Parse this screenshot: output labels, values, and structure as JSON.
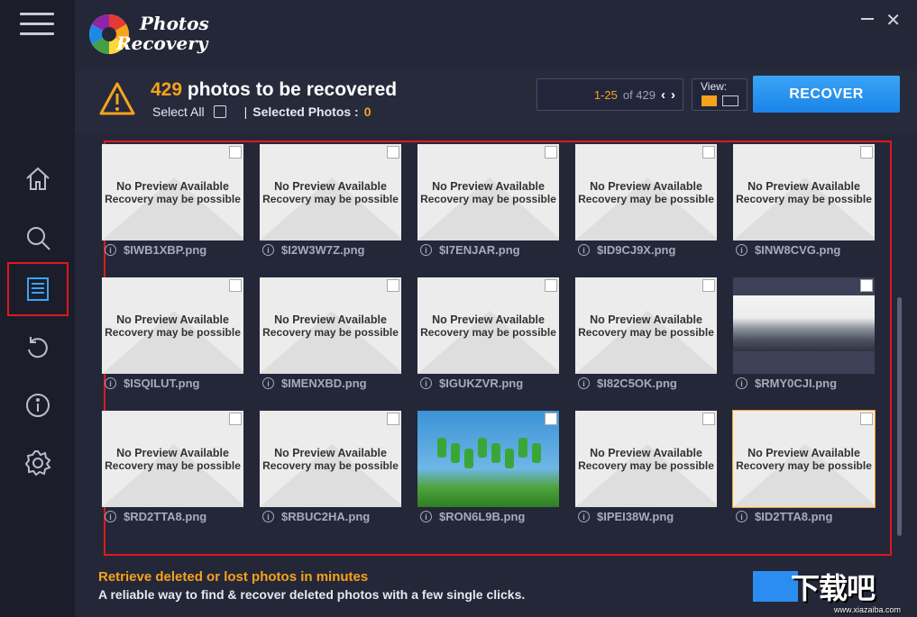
{
  "app": {
    "logo_line1": "Photos",
    "logo_line2": "Recovery",
    "window_close": "✕"
  },
  "header": {
    "count": "429",
    "title_suffix": " photos to be recovered",
    "select_all_label": "Select All",
    "separator": "|",
    "selected_label": "Selected Photos :",
    "selected_count": "0",
    "pager_range": "1-25",
    "pager_of": "of 429",
    "pager_prev": "‹",
    "pager_next": "›",
    "view_label": "View:",
    "recover_label": "RECOVER"
  },
  "thumb_text": {
    "line1": "No Preview Available",
    "line2": "Recovery may be possible"
  },
  "photos": [
    {
      "name": "$IWB1XBP.png",
      "type": "placeholder"
    },
    {
      "name": "$I2W3W7Z.png",
      "type": "placeholder"
    },
    {
      "name": "$I7ENJAR.png",
      "type": "placeholder"
    },
    {
      "name": "$ID9CJ9X.png",
      "type": "placeholder"
    },
    {
      "name": "$INW8CVG.png",
      "type": "placeholder"
    },
    {
      "name": "$ISQILUT.png",
      "type": "placeholder"
    },
    {
      "name": "$IMENXBD.png",
      "type": "placeholder"
    },
    {
      "name": "$IGUKZVR.png",
      "type": "placeholder"
    },
    {
      "name": "$I82C5OK.png",
      "type": "placeholder"
    },
    {
      "name": "$RMY0CJI.png",
      "type": "screenshot"
    },
    {
      "name": "$RD2TTA8.png",
      "type": "placeholder"
    },
    {
      "name": "$RBUC2HA.png",
      "type": "placeholder"
    },
    {
      "name": "$RON6L9B.png",
      "type": "photo"
    },
    {
      "name": "$IPEI38W.png",
      "type": "placeholder"
    },
    {
      "name": "$ID2TTA8.png",
      "type": "placeholder",
      "selected": true
    }
  ],
  "footer": {
    "line1": "Retrieve deleted or lost photos in minutes",
    "line2": "A reliable way to find & recover deleted photos with a few single clicks."
  },
  "watermark": {
    "text": "下载吧",
    "sub": "www.xiazaiba.com"
  },
  "colors": {
    "accent": "#f7a21b",
    "primary": "#2c8df0",
    "highlight": "#e0181d"
  }
}
